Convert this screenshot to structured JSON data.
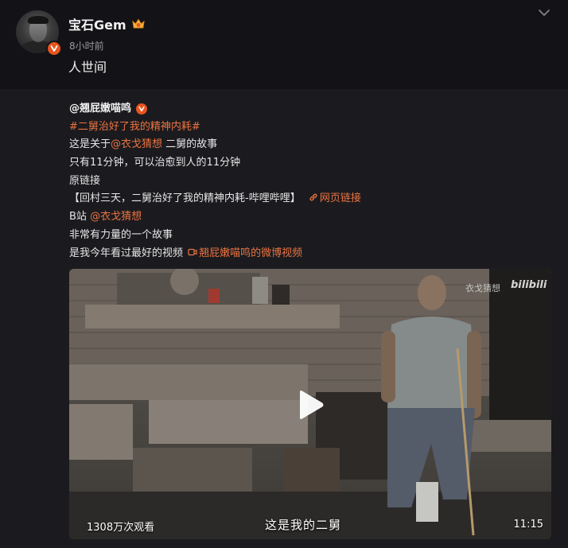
{
  "post": {
    "username": "宝石Gem",
    "timestamp": "8小时前",
    "caption": "人世间"
  },
  "repost": {
    "author": "@翘屁嫩喵鸣",
    "hashtag": "#二舅治好了我的精神内耗#",
    "line3_pre": "这是关于",
    "line3_mention": "@衣戈猜想",
    "line3_post": " 二舅的故事",
    "line4": "只有11分钟，可以治愈到人的11分钟",
    "line5": "原链接",
    "line6_text": "【回村三天，二舅治好了我的精神内耗-哔哩哔哩】",
    "line6_link": "网页链接",
    "line7_pre": "B站 ",
    "line7_mention": "@衣戈猜想",
    "line8": "非常有力量的一个故事",
    "line9_text": "是我今年看过最好的视频",
    "line9_link": "翘屁嫩喵鸣的微博视频"
  },
  "video": {
    "views": "1308万次观看",
    "duration": "11:15",
    "subtitle": "这是我的二舅",
    "watermark_channel": "衣戈猜想",
    "watermark_logo": "bilibili"
  },
  "icons": {
    "verified": "verified-badge-icon",
    "vip": "crown-icon",
    "more": "chevron-down-icon",
    "link": "link-icon",
    "video_link": "video-icon",
    "play": "play-icon"
  },
  "colors": {
    "background": "#131317",
    "card": "#1b1b1f",
    "accent": "#eb7340",
    "badge": "#e8541e"
  }
}
